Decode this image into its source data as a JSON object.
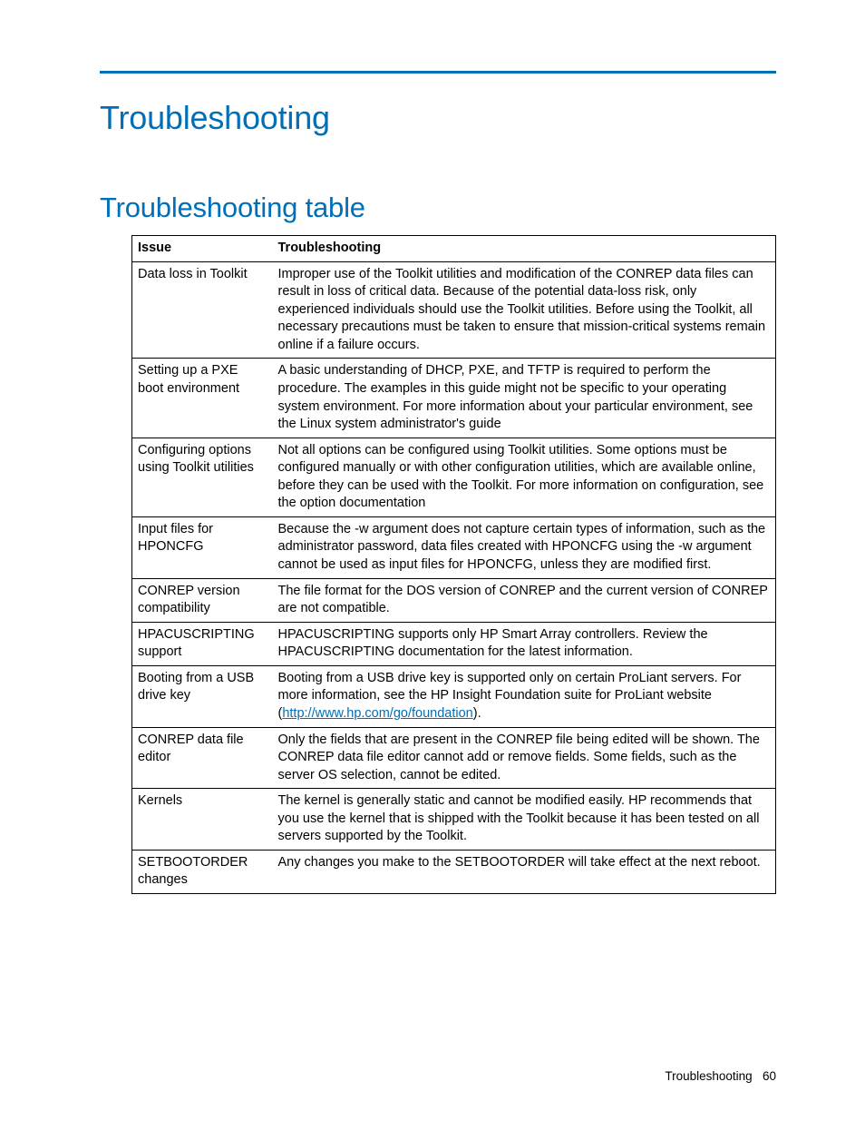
{
  "headings": {
    "h1": "Troubleshooting",
    "h2": "Troubleshooting table"
  },
  "table": {
    "head": {
      "c0": "Issue",
      "c1": "Troubleshooting"
    },
    "rows": [
      {
        "issue": "Data loss in Toolkit",
        "text": "Improper use of the Toolkit utilities and modification of the CONREP data files can result in loss of critical data. Because of the potential data-loss risk, only experienced individuals should use the Toolkit utilities. Before using the Toolkit, all necessary precautions must be taken to ensure that mission-critical systems remain online if a failure occurs."
      },
      {
        "issue": "Setting up a PXE boot environment",
        "text": "A basic understanding of DHCP, PXE, and TFTP is required to perform the procedure. The examples in this guide might not be specific to your operating system environment. For more information about your particular environment, see the Linux system administrator's guide"
      },
      {
        "issue": "Configuring options using Toolkit utilities",
        "text": "Not all options can be configured using Toolkit utilities. Some options must be configured manually or with other configuration utilities, which are available online, before they can be used with the Toolkit. For more information on configuration, see the option documentation"
      },
      {
        "issue": "Input files for HPONCFG",
        "text": "Because the -w argument does not capture certain types of information, such as the administrator password, data files created with HPONCFG using the -w argument cannot be used as input files for HPONCFG, unless they are modified first."
      },
      {
        "issue": "CONREP version compatibility",
        "text": "The file format for the DOS version of CONREP and the current version of CONREP are not compatible."
      },
      {
        "issue": "HPACUSCRIPTING support",
        "text": "HPACUSCRIPTING supports only HP Smart Array controllers. Review the HPACUSCRIPTING documentation for the latest information."
      },
      {
        "issue": "Booting from a USB drive key",
        "pre": "Booting from a USB drive key is supported only on certain ProLiant servers. For more information, see the HP Insight Foundation suite for ProLiant website (",
        "link": "http://www.hp.com/go/foundation",
        "post": ")."
      },
      {
        "issue": "CONREP data file editor",
        "text": "Only the fields that are present in the CONREP file being edited will be shown. The CONREP data file editor cannot add or remove fields. Some fields, such as the server OS selection, cannot be edited."
      },
      {
        "issue": "Kernels",
        "text": "The kernel is generally static and cannot be modified easily. HP recommends that you use the kernel that is shipped with the Toolkit because it has been tested on all servers supported by the Toolkit."
      },
      {
        "issue": "SETBOOTORDER changes",
        "text": "Any changes you make to the SETBOOTORDER will take effect at the next reboot."
      }
    ]
  },
  "footer": {
    "section": "Troubleshooting",
    "page": "60"
  }
}
